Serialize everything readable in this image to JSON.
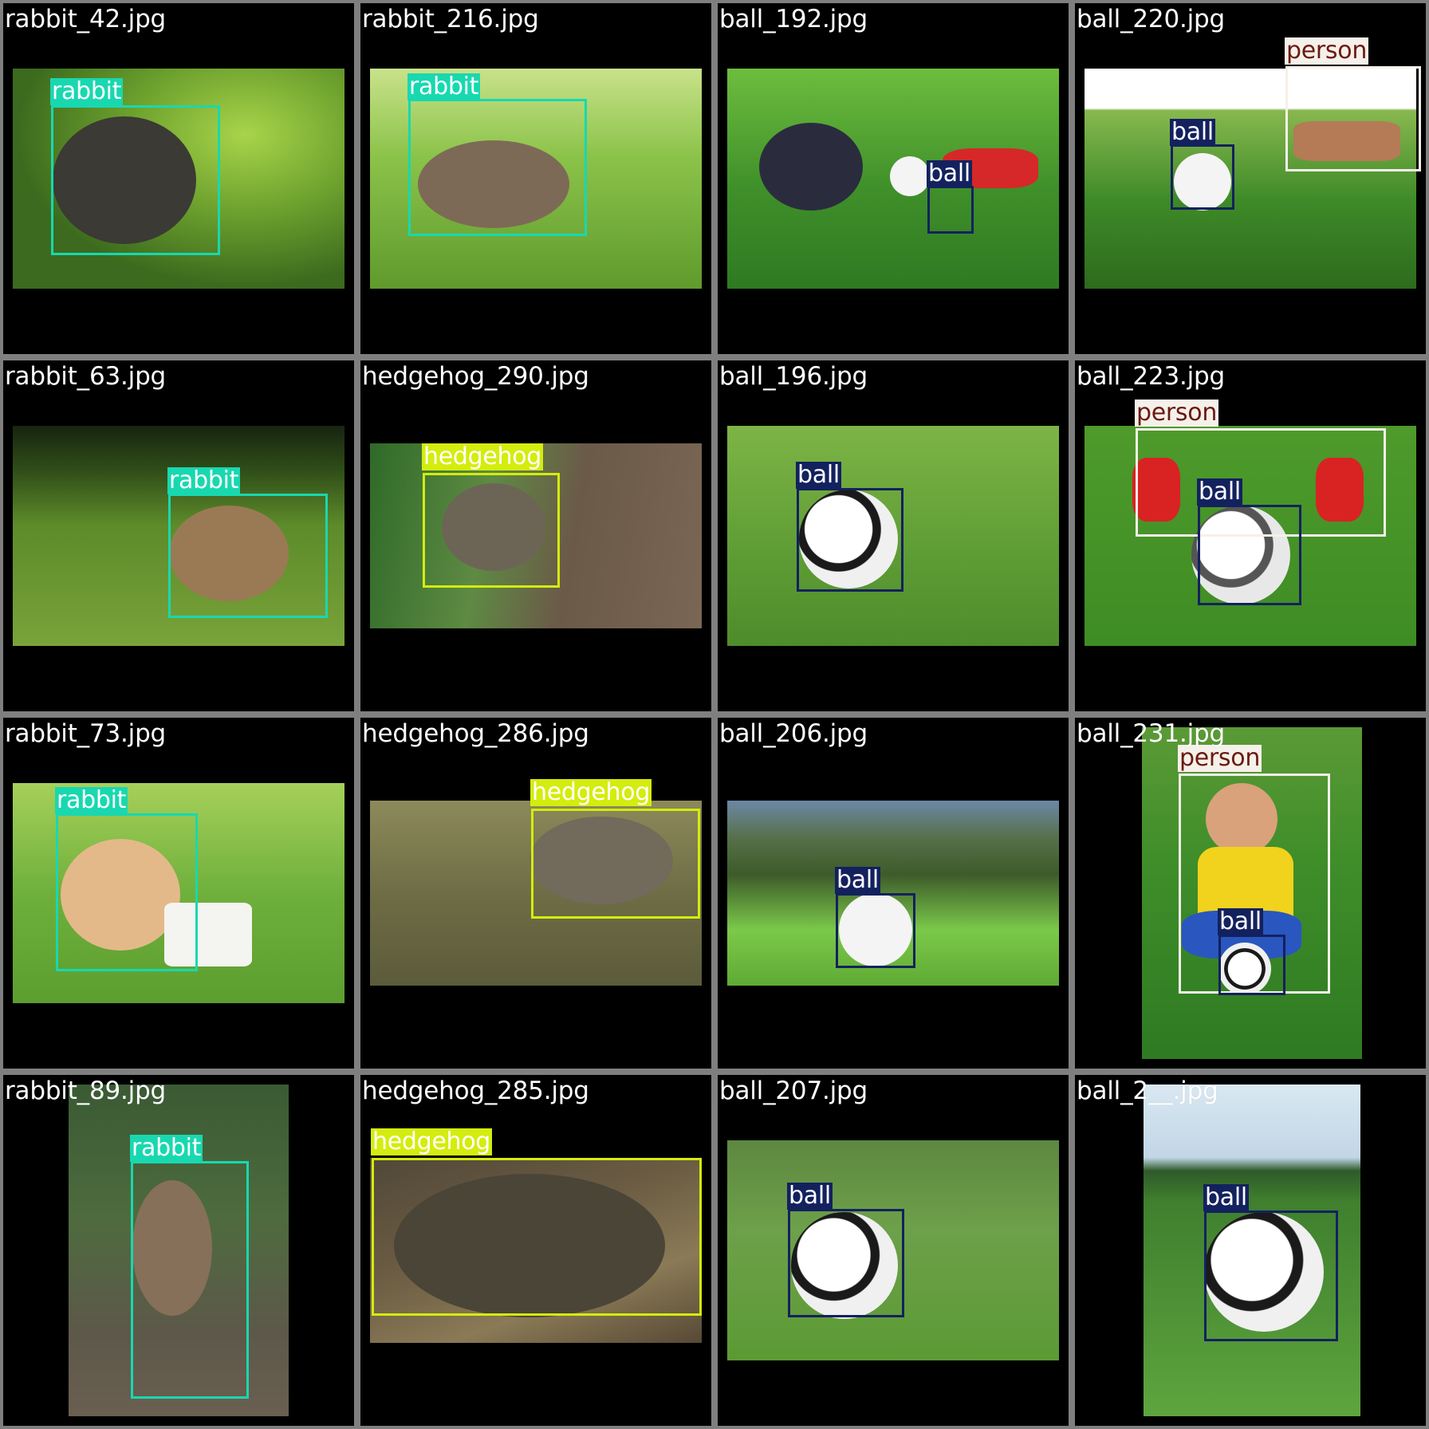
{
  "colors": {
    "frame": "#7f7f7f",
    "rabbit": "#18d8b0",
    "hedgehog": "#d4ec0e",
    "ball": "#13215e",
    "person": "#f5f0ea",
    "person_text": "#6a1a10"
  },
  "cells": [
    {
      "caption": "rabbit_42.jpg",
      "labels": [
        "rabbit"
      ]
    },
    {
      "caption": "rabbit_216.jpg",
      "labels": [
        "rabbit"
      ]
    },
    {
      "caption": "ball_192.jpg",
      "labels": [
        "ball"
      ]
    },
    {
      "caption": "ball_220.jpg",
      "labels": [
        "ball",
        "person"
      ]
    },
    {
      "caption": "rabbit_63.jpg",
      "labels": [
        "rabbit"
      ]
    },
    {
      "caption": "hedgehog_290.jpg",
      "labels": [
        "hedgehog"
      ]
    },
    {
      "caption": "ball_196.jpg",
      "labels": [
        "ball"
      ]
    },
    {
      "caption": "ball_223.jpg",
      "labels": [
        "person",
        "ball"
      ]
    },
    {
      "caption": "rabbit_73.jpg",
      "labels": [
        "rabbit"
      ]
    },
    {
      "caption": "hedgehog_286.jpg",
      "labels": [
        "hedgehog"
      ]
    },
    {
      "caption": "ball_206.jpg",
      "labels": [
        "ball"
      ]
    },
    {
      "caption": "ball_231.jpg",
      "labels": [
        "person",
        "ball"
      ]
    },
    {
      "caption": "rabbit_89.jpg",
      "labels": [
        "rabbit"
      ]
    },
    {
      "caption": "hedgehog_285.jpg",
      "labels": [
        "hedgehog"
      ]
    },
    {
      "caption": "ball_207.jpg",
      "labels": [
        "ball"
      ]
    },
    {
      "caption": "ball_2__.jpg",
      "labels": [
        "ball"
      ]
    }
  ]
}
